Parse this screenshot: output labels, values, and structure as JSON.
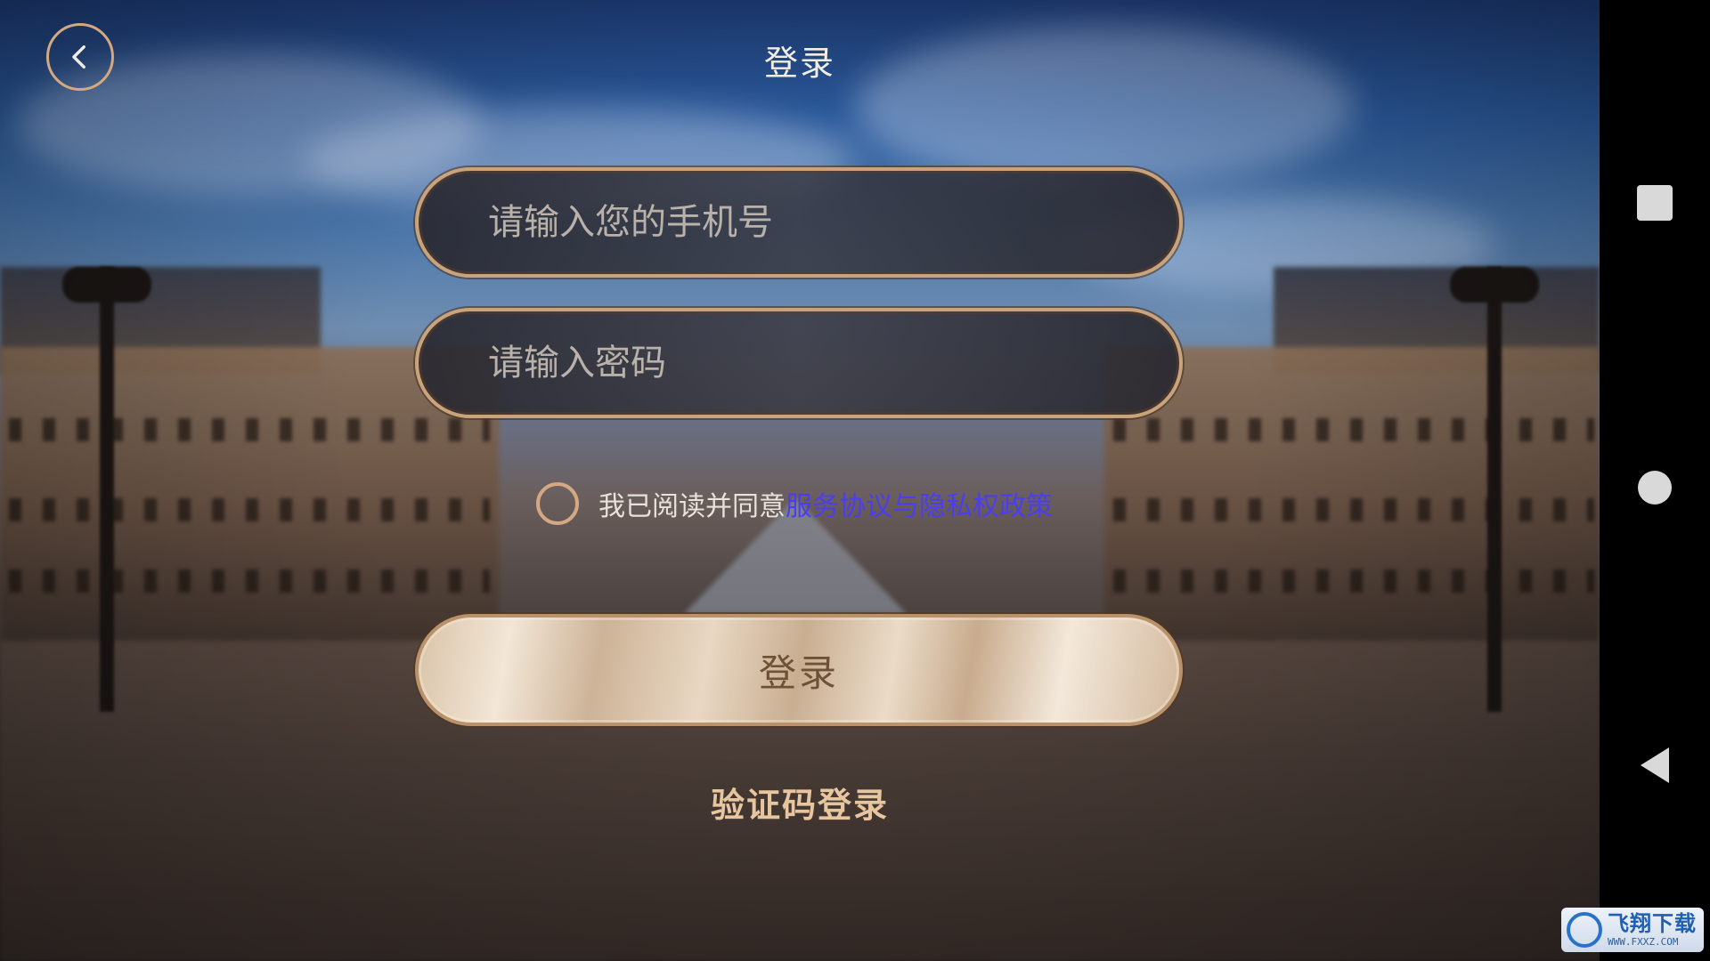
{
  "header": {
    "back_icon": "chevron-left-icon",
    "title": "登录"
  },
  "form": {
    "phone_placeholder": "请输入您的手机号",
    "password_placeholder": "请输入密码",
    "agreement_text": "我已阅读并同意",
    "agreement_link": "服务协议与隐私权政策",
    "login_label": "登录",
    "code_login_label": "验证码登录"
  },
  "colors": {
    "accent_gold": "#d4a982",
    "link_blue": "#4b3df2",
    "code_login_text": "#e7c59e"
  },
  "navbar": {
    "icons": [
      "recent-apps-icon",
      "home-icon",
      "back-triangle-icon"
    ]
  },
  "watermark": {
    "main": "飞翔下载",
    "sub": "WWW.FXXZ.COM"
  }
}
